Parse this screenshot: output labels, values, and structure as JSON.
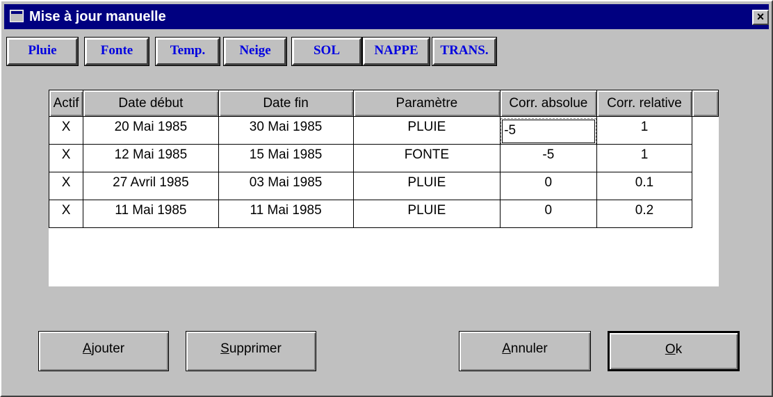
{
  "window": {
    "title": "Mise à jour manuelle",
    "close_label": "×"
  },
  "toolbar": {
    "buttons": [
      {
        "label": "Pluie"
      },
      {
        "label": "Fonte"
      },
      {
        "label": "Temp."
      },
      {
        "label": "Neige"
      },
      {
        "label": "SOL"
      },
      {
        "label": "NAPPE"
      },
      {
        "label": "TRANS."
      }
    ],
    "color": "#0000e0"
  },
  "grid": {
    "columns": [
      "Actif",
      "Date début",
      "Date fin",
      "Paramètre",
      "Corr. absolue",
      "Corr. relative",
      ""
    ],
    "rows": [
      {
        "actif": "X",
        "debut": "20 Mai 1985",
        "fin": "30 Mai 1985",
        "param": "PLUIE",
        "abs": "-5",
        "rel": "1"
      },
      {
        "actif": "X",
        "debut": "12 Mai 1985",
        "fin": "15 Mai 1985",
        "param": "FONTE",
        "abs": "-5",
        "rel": "1"
      },
      {
        "actif": "X",
        "debut": "27 Avril 1985",
        "fin": "03 Mai 1985",
        "param": "PLUIE",
        "abs": "0",
        "rel": "0.1"
      },
      {
        "actif": "X",
        "debut": "11 Mai 1985",
        "fin": "11 Mai 1985",
        "param": "PLUIE",
        "abs": "0",
        "rel": "0.2"
      }
    ]
  },
  "buttons": {
    "add": {
      "accel": "A",
      "rest": "jouter"
    },
    "delete": {
      "accel": "S",
      "rest": "upprimer"
    },
    "cancel": {
      "accel": "A",
      "rest": "nnuler"
    },
    "ok": {
      "accel": "O",
      "rest": "k"
    }
  },
  "colors": {
    "title_bar": "#000080",
    "face": "#c0c0c0"
  }
}
